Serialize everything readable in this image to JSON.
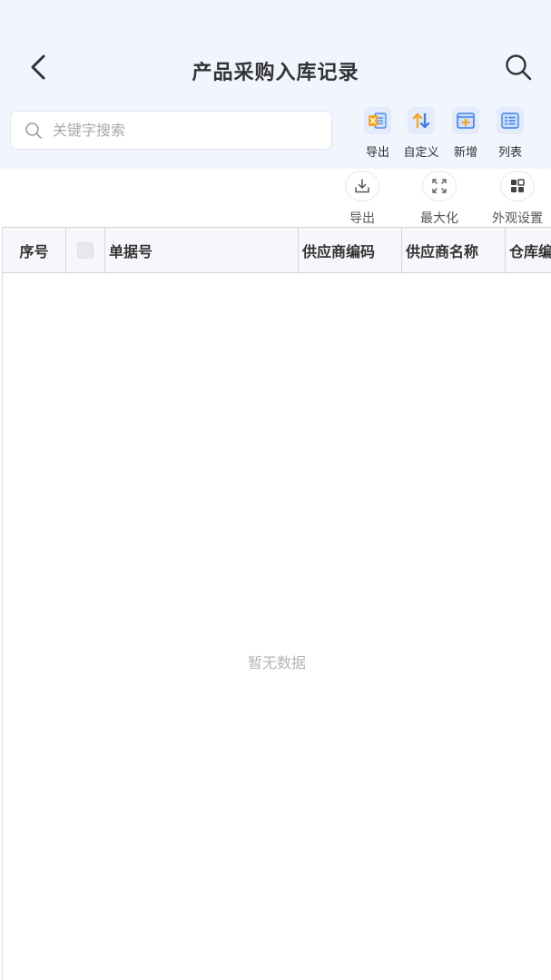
{
  "header": {
    "title": "产品采购入库记录"
  },
  "search": {
    "placeholder": "关键字搜索"
  },
  "toolbar": [
    {
      "label": "导出",
      "icon": "excel-export-icon"
    },
    {
      "label": "自定义",
      "icon": "sort-arrows-icon"
    },
    {
      "label": "新增",
      "icon": "add-box-icon"
    },
    {
      "label": "列表",
      "icon": "list-icon"
    }
  ],
  "actions": [
    {
      "label": "导出",
      "icon": "download-icon"
    },
    {
      "label": "最大化",
      "icon": "maximize-icon"
    },
    {
      "label": "外观设置",
      "icon": "grid-settings-icon"
    }
  ],
  "table": {
    "columns": [
      "序号",
      "",
      "单据号",
      "供应商编码",
      "供应商名称",
      "仓库编码"
    ],
    "empty_text": "暂无数据"
  },
  "colors": {
    "header_bg": "#f1f5fd",
    "accent_blue": "#3f7ff0",
    "accent_orange": "#f5a623"
  }
}
